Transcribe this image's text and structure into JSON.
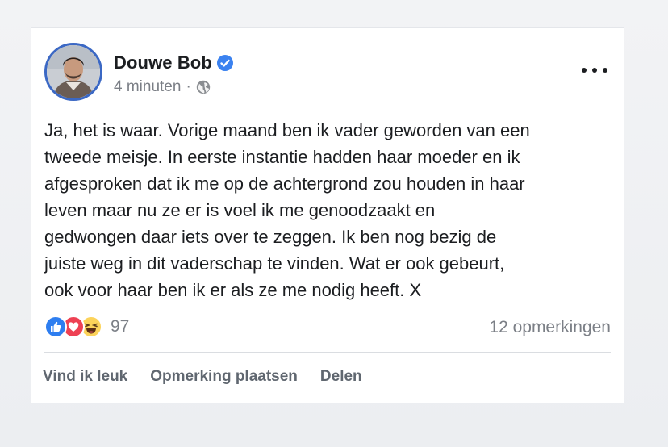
{
  "post": {
    "author": "Douwe Bob",
    "timestamp": "4 minuten",
    "separator": "·",
    "privacy_icon": "globe-icon",
    "verified_icon": "verified-badge-icon",
    "text": "Ja, het is waar. Vorige maand ben ik vader geworden van een\ntweede meisje. In eerste instantie hadden haar moeder en ik\nafgesproken dat ik me op de achtergrond zou houden in haar\nleven maar nu ze er is voel ik me genoodzaakt en\ngedwongen daar iets over te zeggen. Ik ben nog bezig de\njuiste weg in dit vaderschap te vinden. Wat er ook gebeurt,\nook voor haar ben ik er als ze me nodig heeft. X"
  },
  "reactions": {
    "types": [
      "like",
      "love",
      "haha"
    ],
    "count": "97"
  },
  "comments_label": "12 opmerkingen",
  "actions": {
    "like": "Vind ik leuk",
    "comment": "Opmerking plaatsen",
    "share": "Delen"
  },
  "colors": {
    "verified": "#3b82f0",
    "like": "#2e7ef0",
    "love": "#ee4153",
    "haha": "#fcd35a",
    "avatar_ring": "#3b68c4"
  }
}
